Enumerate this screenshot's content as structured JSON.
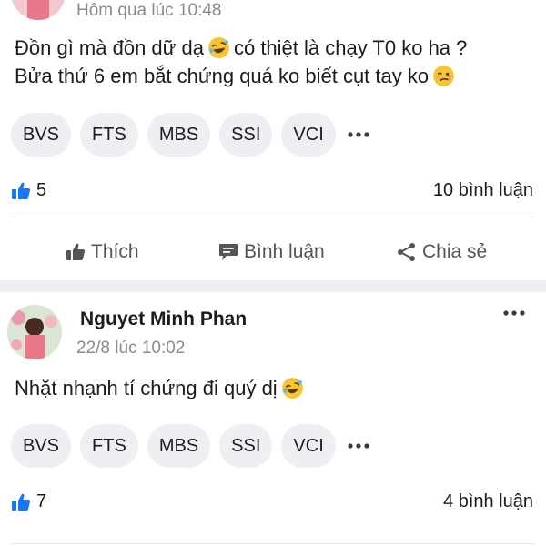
{
  "posts": [
    {
      "timestamp": "Hôm qua lúc 10:48",
      "content_line1_a": "Đồn gì mà đồn dữ dạ",
      "content_line1_b": "có thiệt là chạy T0 ko ha ?",
      "content_line2_a": "Bửa thứ 6 em bắt chứng quá ko biết cụt tay ko",
      "tags": [
        "BVS",
        "FTS",
        "MBS",
        "SSI",
        "VCI"
      ],
      "likes": "5",
      "comments": "10 bình luận",
      "actions": {
        "like": "Thích",
        "comment": "Bình luận",
        "share": "Chia sẻ"
      }
    },
    {
      "author": "Nguyet Minh Phan",
      "timestamp": "22/8 lúc 10:02",
      "content": "Nhặt nhạnh tí chứng đi quý dị",
      "tags": [
        "BVS",
        "FTS",
        "MBS",
        "SSI",
        "VCI"
      ],
      "likes": "7",
      "comments": "4 bình luận"
    }
  ],
  "icons": {
    "like": "thumbs-up-icon",
    "comment": "chat-bubble-icon",
    "share": "share-icon",
    "more": "more-dots-icon",
    "emoji_laugh": "rolling-laughing-emoji",
    "emoji_woozy": "woozy-face-emoji"
  },
  "colors": {
    "like_blue": "#1877f2",
    "tag_bg": "#eeeff2",
    "muted": "#8a8a8e",
    "separator": "#eceef1"
  }
}
